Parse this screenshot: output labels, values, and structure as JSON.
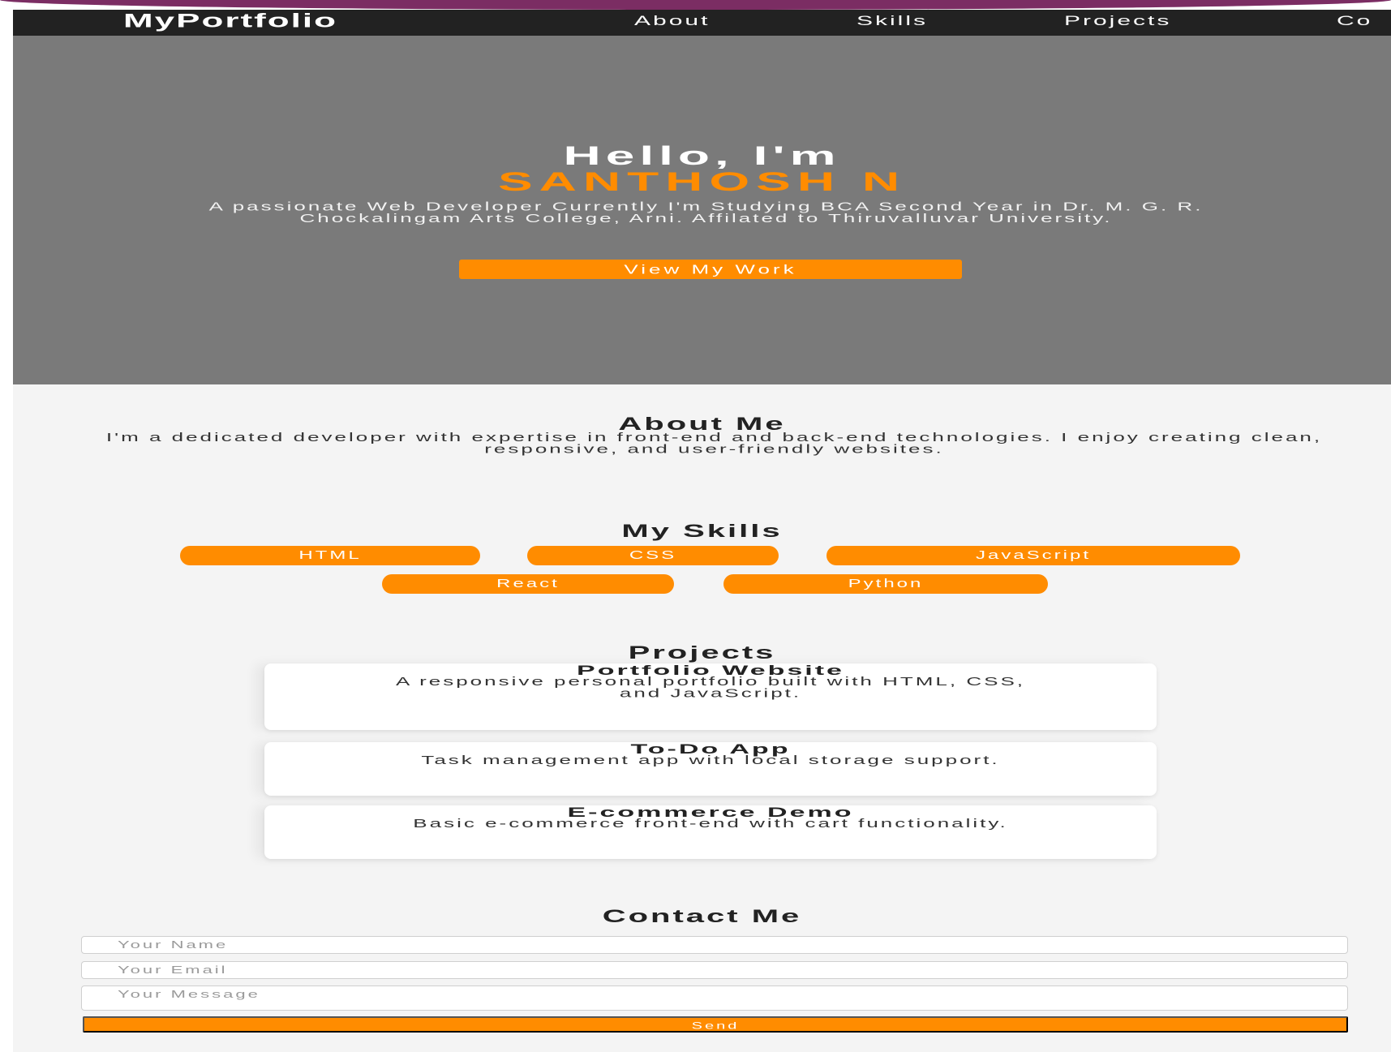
{
  "nav": {
    "logo": "MyPortfolio",
    "links": [
      "About",
      "Skills",
      "Projects",
      "Co"
    ]
  },
  "hero": {
    "greeting": "Hello, I'm",
    "name": "SANTHOSH N",
    "description": "A passionate Web Developer Currently I'm Studying BCA Second Year in Dr. M. G. R. Chockalingam Arts College, Arni. Affilated to Thiruvalluvar University.",
    "cta_label": "View My Work"
  },
  "about": {
    "title": "About Me",
    "text": "I'm a dedicated developer with expertise in front-end and back-end technologies. I enjoy creating clean, responsive, and user-friendly websites."
  },
  "skills": {
    "title": "My Skills",
    "items": [
      "HTML",
      "CSS",
      "JavaScript",
      "React",
      "Python"
    ]
  },
  "projects": {
    "title": "Projects",
    "items": [
      {
        "title": "Portfolio Website",
        "description": "A responsive personal portfolio built with HTML, CSS, and JavaScript."
      },
      {
        "title": "To-Do App",
        "description": "Task management app with local storage support."
      },
      {
        "title": "E-commerce Demo",
        "description": "Basic e-commerce front-end with cart functionality."
      }
    ]
  },
  "contact": {
    "title": "Contact Me",
    "name_placeholder": "Your Name",
    "email_placeholder": "Your Email",
    "message_placeholder": "Your  Message",
    "send_label": "Send"
  },
  "colors": {
    "accent": "#ff8c00",
    "nav_bg": "#222222",
    "hero_bg": "#7a7a7a",
    "page_bg": "#f4f4f4"
  }
}
